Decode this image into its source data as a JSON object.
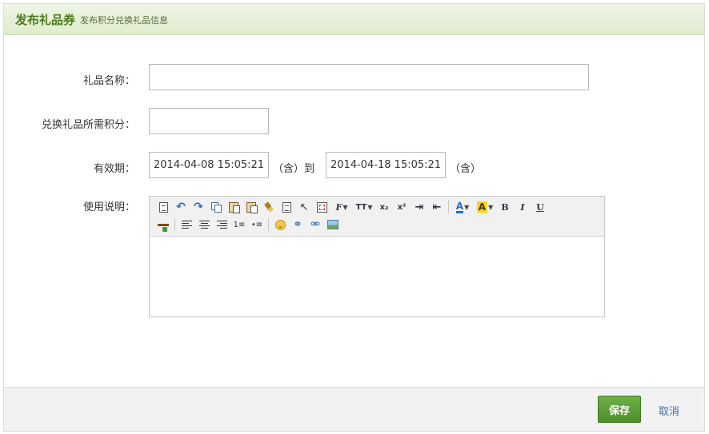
{
  "header": {
    "title": "发布礼品券",
    "subtitle": "发布积分兑换礼品信息"
  },
  "form": {
    "gift_name": {
      "label": "礼品名称：",
      "value": ""
    },
    "points": {
      "label": "兑换礼品所需积分：",
      "value": ""
    },
    "validity": {
      "label": "有效期：",
      "start": "2014-04-08 15:05:21",
      "inclusive_start": "（含）到",
      "end": "2014-04-18 15:05:21",
      "inclusive_end": "（含）"
    },
    "instructions": {
      "label": "使用说明：",
      "value": ""
    }
  },
  "toolbar": {
    "font_family_glyph": "F",
    "font_size_glyph": "TT",
    "subscript_glyph": "x₂",
    "superscript_glyph": "x²",
    "font_color_glyph": "A",
    "bg_color_glyph": "A",
    "bold_glyph": "B",
    "italic_glyph": "I",
    "underline_glyph": "U",
    "undo_glyph": "↶",
    "redo_glyph": "↷",
    "select_glyph": "↖",
    "link_glyph": "⚭",
    "unlink_glyph": "⚮",
    "indent_glyph": "⇥",
    "outdent_glyph": "⇤",
    "ordered_list_glyph": "1≡",
    "unordered_list_glyph": "•≡"
  },
  "footer": {
    "save_label": "保存",
    "cancel_label": "取消"
  },
  "colors": {
    "accent_green": "#4d8f2a",
    "link_blue": "#3b6fb6",
    "header_bg": "#dfeccd"
  }
}
